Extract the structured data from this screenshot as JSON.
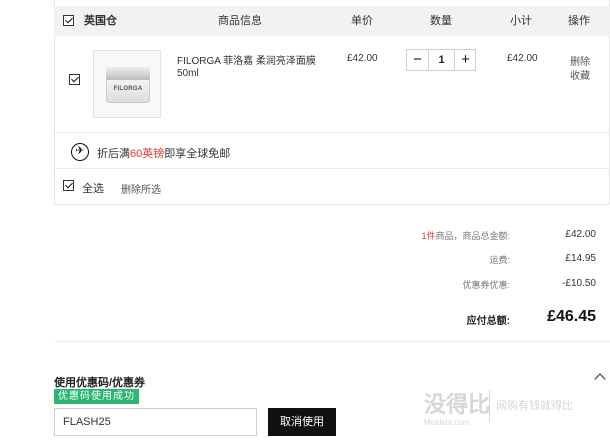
{
  "header": {
    "warehouse": "英国仓",
    "product_info": "商品信息",
    "unit_price": "单价",
    "quantity": "数量",
    "subtotal": "小计",
    "action": "操作"
  },
  "item": {
    "name_line1": "FILORGA 菲洛嘉 柔润亮泽面膜",
    "name_line2": "50ml",
    "image_brand": "FILORGA",
    "price": "£42.00",
    "qty": "1",
    "subtotal": "£42.00",
    "delete": "删除",
    "favorite": "收藏"
  },
  "shipping": {
    "prefix": "折后满",
    "amount": "60英镑",
    "suffix": "即享全球免邮"
  },
  "footer": {
    "select_all": "全选",
    "delete_selected": "删除所选"
  },
  "summary": {
    "count": "1件",
    "total_label": "商品，商品总金额:",
    "total_value": "£42.00",
    "shipping_label": "运费:",
    "shipping_value": "£14.95",
    "coupon_label": "优惠券优惠:",
    "coupon_value": "-£10.50",
    "payable_label": "应付总额:",
    "payable_value": "£46.45"
  },
  "coupon": {
    "title": "使用优惠码/优惠券",
    "badge": "优惠码使用成功",
    "code": "FLASH25",
    "cancel": "取消使用"
  },
  "watermark": {
    "brand": "没得比",
    "sub": "Meidebi.com",
    "slogan": "网购有钱就得比"
  },
  "colors": {
    "accent_red": "#e0322e",
    "success_green": "#2bb673",
    "button_dark": "#111111"
  }
}
